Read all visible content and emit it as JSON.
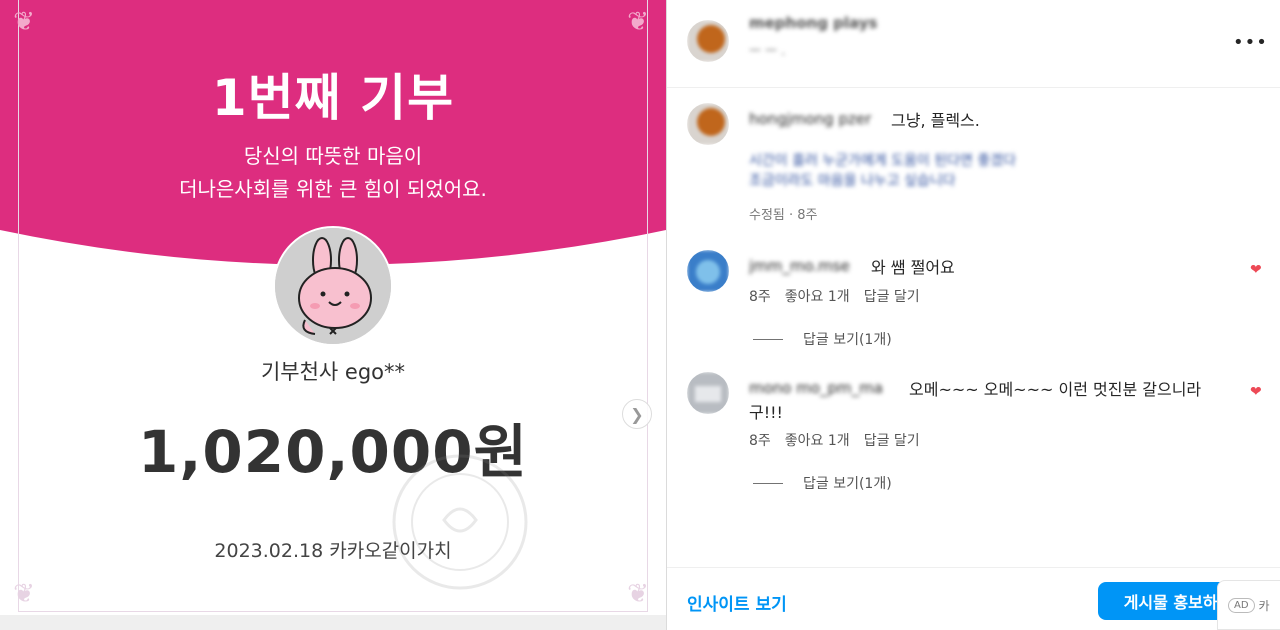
{
  "colors": {
    "pink": "#dd2d7f",
    "accent": "#0095f6",
    "heart": "#ed4956"
  },
  "donation_card": {
    "title": "1번째 기부",
    "line1": "당신의 따뜻한 마음이",
    "line2": "더나은사회를 위한 큰 힘이 되었어요.",
    "donor": "기부천사 ego**",
    "amount": "1,020,000원",
    "date_source": "2023.02.18 카카오같이가치"
  },
  "post": {
    "author_name": "mephong plays",
    "author_sub": "ㅡ ㅡ ."
  },
  "comments": [
    {
      "user": "hongjmong pzer",
      "text": "그냥, 플렉스.",
      "extra_text_line1": "시간이 흘러 누군가에게 도움이 된다면 좋겠다 ",
      "extra_text_line2": "조금이라도 마음을 나누고 싶습니다",
      "meta_time": "수정됨 · 8주",
      "avatar_icon": "orange-avatar-icon"
    },
    {
      "user": "jmm_mo.mse",
      "text": "와 쌤 쩔어요",
      "meta_time": "8주",
      "meta_likes": "좋아요 1개",
      "meta_reply": "답글 달기",
      "view_replies": "답글 보기(1개)",
      "liked": true,
      "avatar_icon": "blue-avatar-icon"
    },
    {
      "user": "mono mo_pm_ma",
      "text": "오메~~~ 오메~~~ 이런 멋진분 갈으니라",
      "text_cont": "구!!!",
      "meta_time": "8주",
      "meta_likes": "좋아요 1개",
      "meta_reply": "답글 달기",
      "view_replies": "답글 보기(1개)",
      "liked": true,
      "avatar_icon": "gray-avatar-icon"
    }
  ],
  "footer": {
    "insight_label": "인사이트 보기",
    "promote_label": "게시물 홍보하기",
    "ad_badge": "AD",
    "ad_text": "카"
  }
}
